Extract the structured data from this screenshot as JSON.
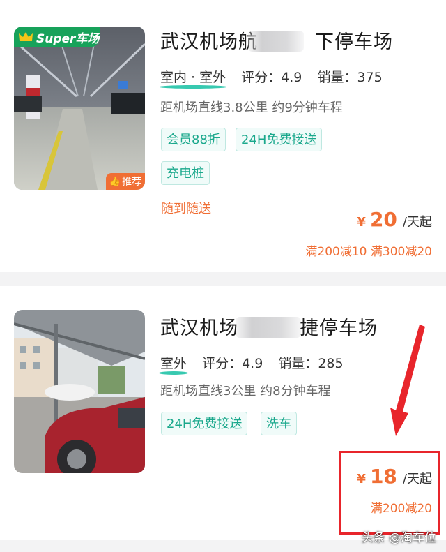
{
  "listings": [
    {
      "title_left": "武汉机场航",
      "title_right": "下停车场",
      "badge_text": "Super车场",
      "recommend_label": "推荐",
      "location_tags": "室内 · 室外",
      "rating_label": "评分：4.9",
      "sales_label": "销量：375",
      "distance_text": "距机场直线3.8公里 约9分钟车程",
      "tags": [
        "会员88折",
        "24H免费接送",
        "充电桩"
      ],
      "shuttle_note": "随到随送",
      "currency": "¥",
      "price": "20",
      "price_unit": "/天起",
      "discount_text": "满200减10 满300减20"
    },
    {
      "title_left": "武汉机场",
      "title_right": "捷停车场",
      "location_tags": "室外",
      "rating_label": "评分：4.9",
      "sales_label": "销量：285",
      "distance_text": "距机场直线3公里 约8分钟车程",
      "tags": [
        "24H免费接送",
        "洗车"
      ],
      "currency": "¥",
      "price": "18",
      "price_unit": "/天起",
      "discount_text": "满200减20"
    }
  ],
  "watermark": "头条 @淘车位",
  "colors": {
    "accent": "#f06e34",
    "tag_green": "#1aa88c",
    "highlight_red": "#e8252b",
    "badge_green": "#17a25a"
  }
}
